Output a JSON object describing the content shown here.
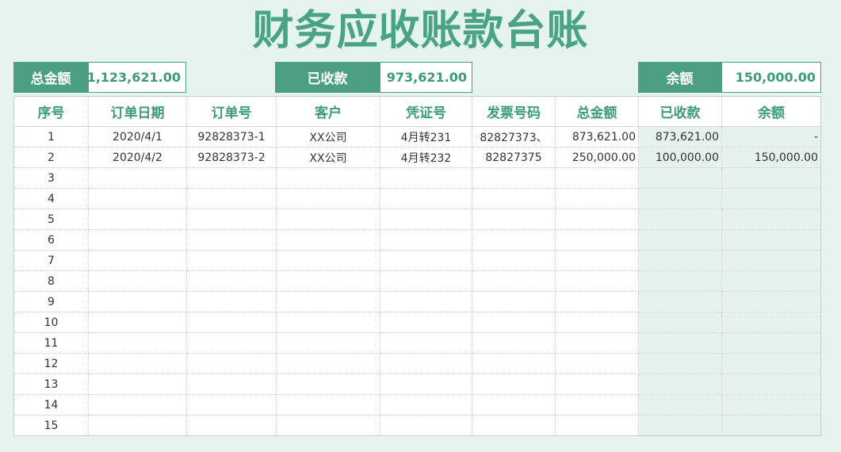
{
  "title": "财务应收账款台账",
  "summary": {
    "total_label": "总金额",
    "total_value": "1,123,621.00",
    "received_label": "已收款",
    "received_value": "973,621.00",
    "balance_label": "余额",
    "balance_value": "150,000.00"
  },
  "table": {
    "headers": [
      "序号",
      "订单日期",
      "订单号",
      "客户",
      "凭证号",
      "发票号码",
      "总金额",
      "已收款",
      "余额"
    ],
    "rows": [
      [
        "1",
        "2020/4/1",
        "92828373-1",
        "XX公司",
        "4月转231",
        "82827373、",
        "873,621.00",
        "873,621.00",
        "-"
      ],
      [
        "2",
        "2020/4/2",
        "92828373-2",
        "XX公司",
        "4月转232",
        "82827375",
        "250,000.00",
        "100,000.00",
        "150,000.00"
      ],
      [
        "3",
        "",
        "",
        "",
        "",
        "",
        "",
        "",
        ""
      ],
      [
        "4",
        "",
        "",
        "",
        "",
        "",
        "",
        "",
        ""
      ],
      [
        "5",
        "",
        "",
        "",
        "",
        "",
        "",
        "",
        ""
      ],
      [
        "6",
        "",
        "",
        "",
        "",
        "",
        "",
        "",
        ""
      ],
      [
        "7",
        "",
        "",
        "",
        "",
        "",
        "",
        "",
        ""
      ],
      [
        "8",
        "",
        "",
        "",
        "",
        "",
        "",
        "",
        ""
      ],
      [
        "9",
        "",
        "",
        "",
        "",
        "",
        "",
        "",
        ""
      ],
      [
        "10",
        "",
        "",
        "",
        "",
        "",
        "",
        "",
        ""
      ],
      [
        "11",
        "",
        "",
        "",
        "",
        "",
        "",
        "",
        ""
      ],
      [
        "12",
        "",
        "",
        "",
        "",
        "",
        "",
        "",
        ""
      ],
      [
        "13",
        "",
        "",
        "",
        "",
        "",
        "",
        "",
        ""
      ],
      [
        "14",
        "",
        "",
        "",
        "",
        "",
        "",
        "",
        ""
      ],
      [
        "15",
        "",
        "",
        "",
        "",
        "",
        "",
        "",
        ""
      ]
    ]
  },
  "colors": {
    "accent": "#4d9f84",
    "title": "#4ba386",
    "background": "#e6f4ef",
    "shade": "#e6f2ee"
  }
}
